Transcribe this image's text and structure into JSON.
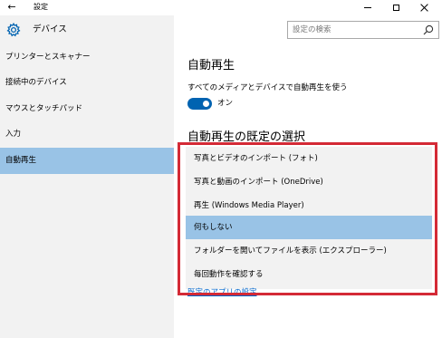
{
  "window": {
    "title": "設定",
    "back_glyph": "←",
    "controls": [
      "minimize",
      "maximize",
      "close"
    ]
  },
  "sidebar": {
    "header_title": "デバイス",
    "items": [
      {
        "label": "プリンターとスキャナー",
        "selected": false
      },
      {
        "label": "接続中のデバイス",
        "selected": false
      },
      {
        "label": "マウスとタッチパッド",
        "selected": false
      },
      {
        "label": "入力",
        "selected": false
      },
      {
        "label": "自動再生",
        "selected": true
      }
    ]
  },
  "search": {
    "placeholder": "設定の検索",
    "icon": "search-icon"
  },
  "main": {
    "section_title": "自動再生",
    "autoplay_label": "すべてのメディアとデバイスで自動再生を使う",
    "toggle_state": "オン",
    "toggle_on": true,
    "defaults_title": "自動再生の既定の選択",
    "options": [
      {
        "label": "写真とビデオのインポート (フォト)",
        "selected": false
      },
      {
        "label": "写真と動画のインポート (OneDrive)",
        "selected": false
      },
      {
        "label": "再生 (Windows Media Player)",
        "selected": false
      },
      {
        "label": "何もしない",
        "selected": true
      },
      {
        "label": "フォルダーを開いてファイルを表示 (エクスプローラー)",
        "selected": false
      },
      {
        "label": "毎回動作を確認する",
        "selected": false
      }
    ],
    "link": "既定のアプリの設定"
  },
  "colors": {
    "accent": "#0063b1",
    "selection": "#99c3e6",
    "sidebar_bg": "#f2f2f2",
    "annotation_red": "#d42a36",
    "link": "#0066cc"
  }
}
